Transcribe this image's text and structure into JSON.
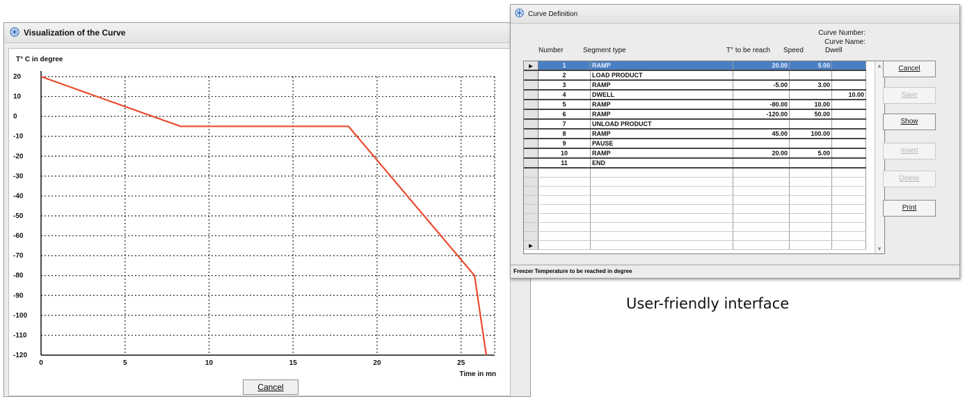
{
  "viz_window": {
    "title": "Visualization of the Curve",
    "cancel_label": "Cancel"
  },
  "chart_data": {
    "type": "line",
    "ylabel": "T° C in degree",
    "xlabel": "Time in mn",
    "xlim": [
      0,
      27
    ],
    "ylim": [
      -120,
      20
    ],
    "x_ticks": [
      0,
      5,
      10,
      15,
      20,
      25
    ],
    "y_ticks": [
      20,
      10,
      0,
      -10,
      -20,
      -30,
      -40,
      -50,
      -60,
      -70,
      -80,
      -90,
      -100,
      -110,
      -120
    ],
    "grid": true,
    "line_color": "#ea4a2c",
    "series": [
      {
        "x": [
          0,
          8.3,
          18.3,
          25.8,
          26.5
        ],
        "y": [
          20,
          -5,
          -5,
          -80,
          -120
        ]
      }
    ]
  },
  "curve_window": {
    "title": "Curve Definition",
    "curve_number_label": "Curve Number:",
    "curve_name_label": "Curve Name:",
    "columns": [
      "Number",
      "Segment type",
      "T° to be reach",
      "Speed",
      "Dwell"
    ],
    "rows": [
      {
        "num": "1",
        "type": "RAMP",
        "reach": "20.00",
        "speed": "5.00",
        "dwell": ""
      },
      {
        "num": "2",
        "type": "LOAD PRODUCT",
        "reach": "",
        "speed": "",
        "dwell": ""
      },
      {
        "num": "3",
        "type": "RAMP",
        "reach": "-5.00",
        "speed": "3.00",
        "dwell": ""
      },
      {
        "num": "4",
        "type": "DWELL",
        "reach": "",
        "speed": "",
        "dwell": "10.00"
      },
      {
        "num": "5",
        "type": "RAMP",
        "reach": "-80.00",
        "speed": "10.00",
        "dwell": ""
      },
      {
        "num": "6",
        "type": "RAMP",
        "reach": "-120.00",
        "speed": "50.00",
        "dwell": ""
      },
      {
        "num": "7",
        "type": "UNLOAD PRODUCT",
        "reach": "",
        "speed": "",
        "dwell": ""
      },
      {
        "num": "8",
        "type": "RAMP",
        "reach": "45.00",
        "speed": "100.00",
        "dwell": ""
      },
      {
        "num": "9",
        "type": "PAUSE",
        "reach": "",
        "speed": "",
        "dwell": ""
      },
      {
        "num": "10",
        "type": "RAMP",
        "reach": "20.00",
        "speed": "5.00",
        "dwell": ""
      },
      {
        "num": "11",
        "type": "END",
        "reach": "",
        "speed": "",
        "dwell": ""
      }
    ],
    "selected_row": 1,
    "buttons": {
      "cancel": "Cancel",
      "save": "Save",
      "show": "Show",
      "insert": "Insert",
      "delete": "Delete",
      "print": "Print"
    },
    "status": "Freezer Temperature to be reached in degree"
  },
  "caption": "User-friendly interface",
  "colors": {
    "selection": "#4a7fc4",
    "curve": "#ea4a2c"
  }
}
